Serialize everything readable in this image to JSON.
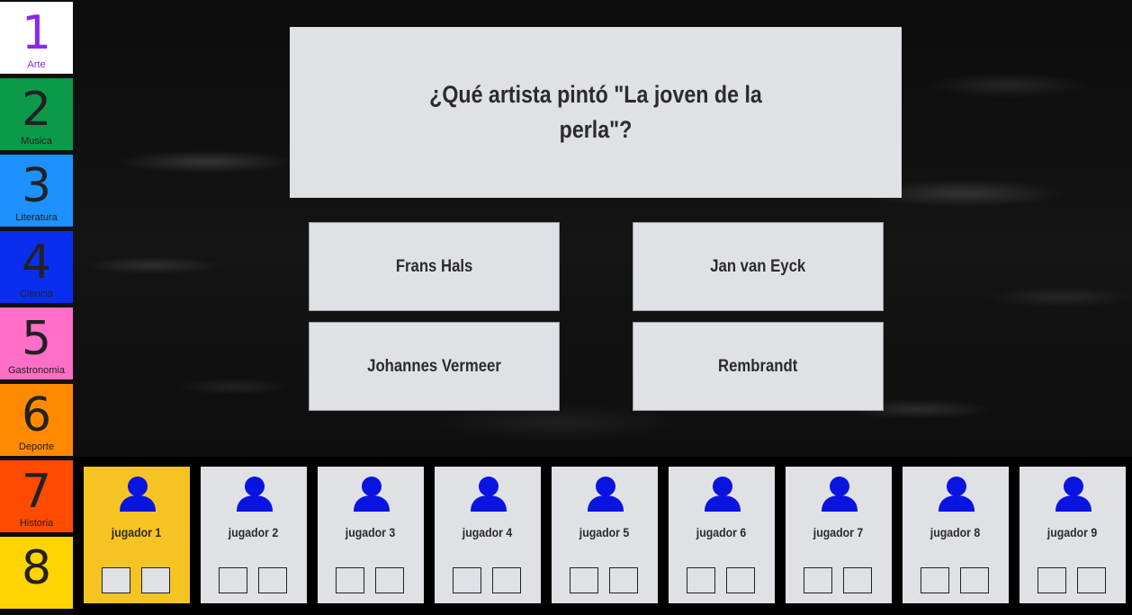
{
  "categories": [
    {
      "number": "1",
      "label": "Arte",
      "color": "#ffffff",
      "num_color": "#8a2be2",
      "label_color": "#8a2be2"
    },
    {
      "number": "2",
      "label": "Musica",
      "color": "#0c9a4a",
      "num_color": "#222222",
      "label_color": "#222222"
    },
    {
      "number": "3",
      "label": "Literatura",
      "color": "#1e90ff",
      "num_color": "#222222",
      "label_color": "#222222"
    },
    {
      "number": "4",
      "label": "Ciencia",
      "color": "#0a2ef0",
      "num_color": "#222222",
      "label_color": "#222222"
    },
    {
      "number": "5",
      "label": "Gastronomia",
      "color": "#ff6ec7",
      "num_color": "#222222",
      "label_color": "#222222"
    },
    {
      "number": "6",
      "label": "Deporte",
      "color": "#ff8a00",
      "num_color": "#222222",
      "label_color": "#222222"
    },
    {
      "number": "7",
      "label": "Historia",
      "color": "#ff4a00",
      "num_color": "#222222",
      "label_color": "#222222"
    },
    {
      "number": "8",
      "label": "",
      "color": "#ffd400",
      "num_color": "#222222",
      "label_color": "#222222"
    }
  ],
  "question": {
    "text": "¿Qué artista pintó \"La joven de la perla\"?"
  },
  "answers": [
    "Frans Hals",
    "Jan van Eyck",
    "Johannes Vermeer",
    "Rembrandt"
  ],
  "players": [
    {
      "name": "jugador 1",
      "active": true
    },
    {
      "name": "jugador 2",
      "active": false
    },
    {
      "name": "jugador 3",
      "active": false
    },
    {
      "name": "jugador 4",
      "active": false
    },
    {
      "name": "jugador 5",
      "active": false
    },
    {
      "name": "jugador 6",
      "active": false
    },
    {
      "name": "jugador 7",
      "active": false
    },
    {
      "name": "jugador 8",
      "active": false
    },
    {
      "name": "jugador 9",
      "active": false
    }
  ],
  "colors": {
    "player_icon": "#0a14e0",
    "active_player": "#f6c422",
    "card": "#dfe1e5"
  }
}
